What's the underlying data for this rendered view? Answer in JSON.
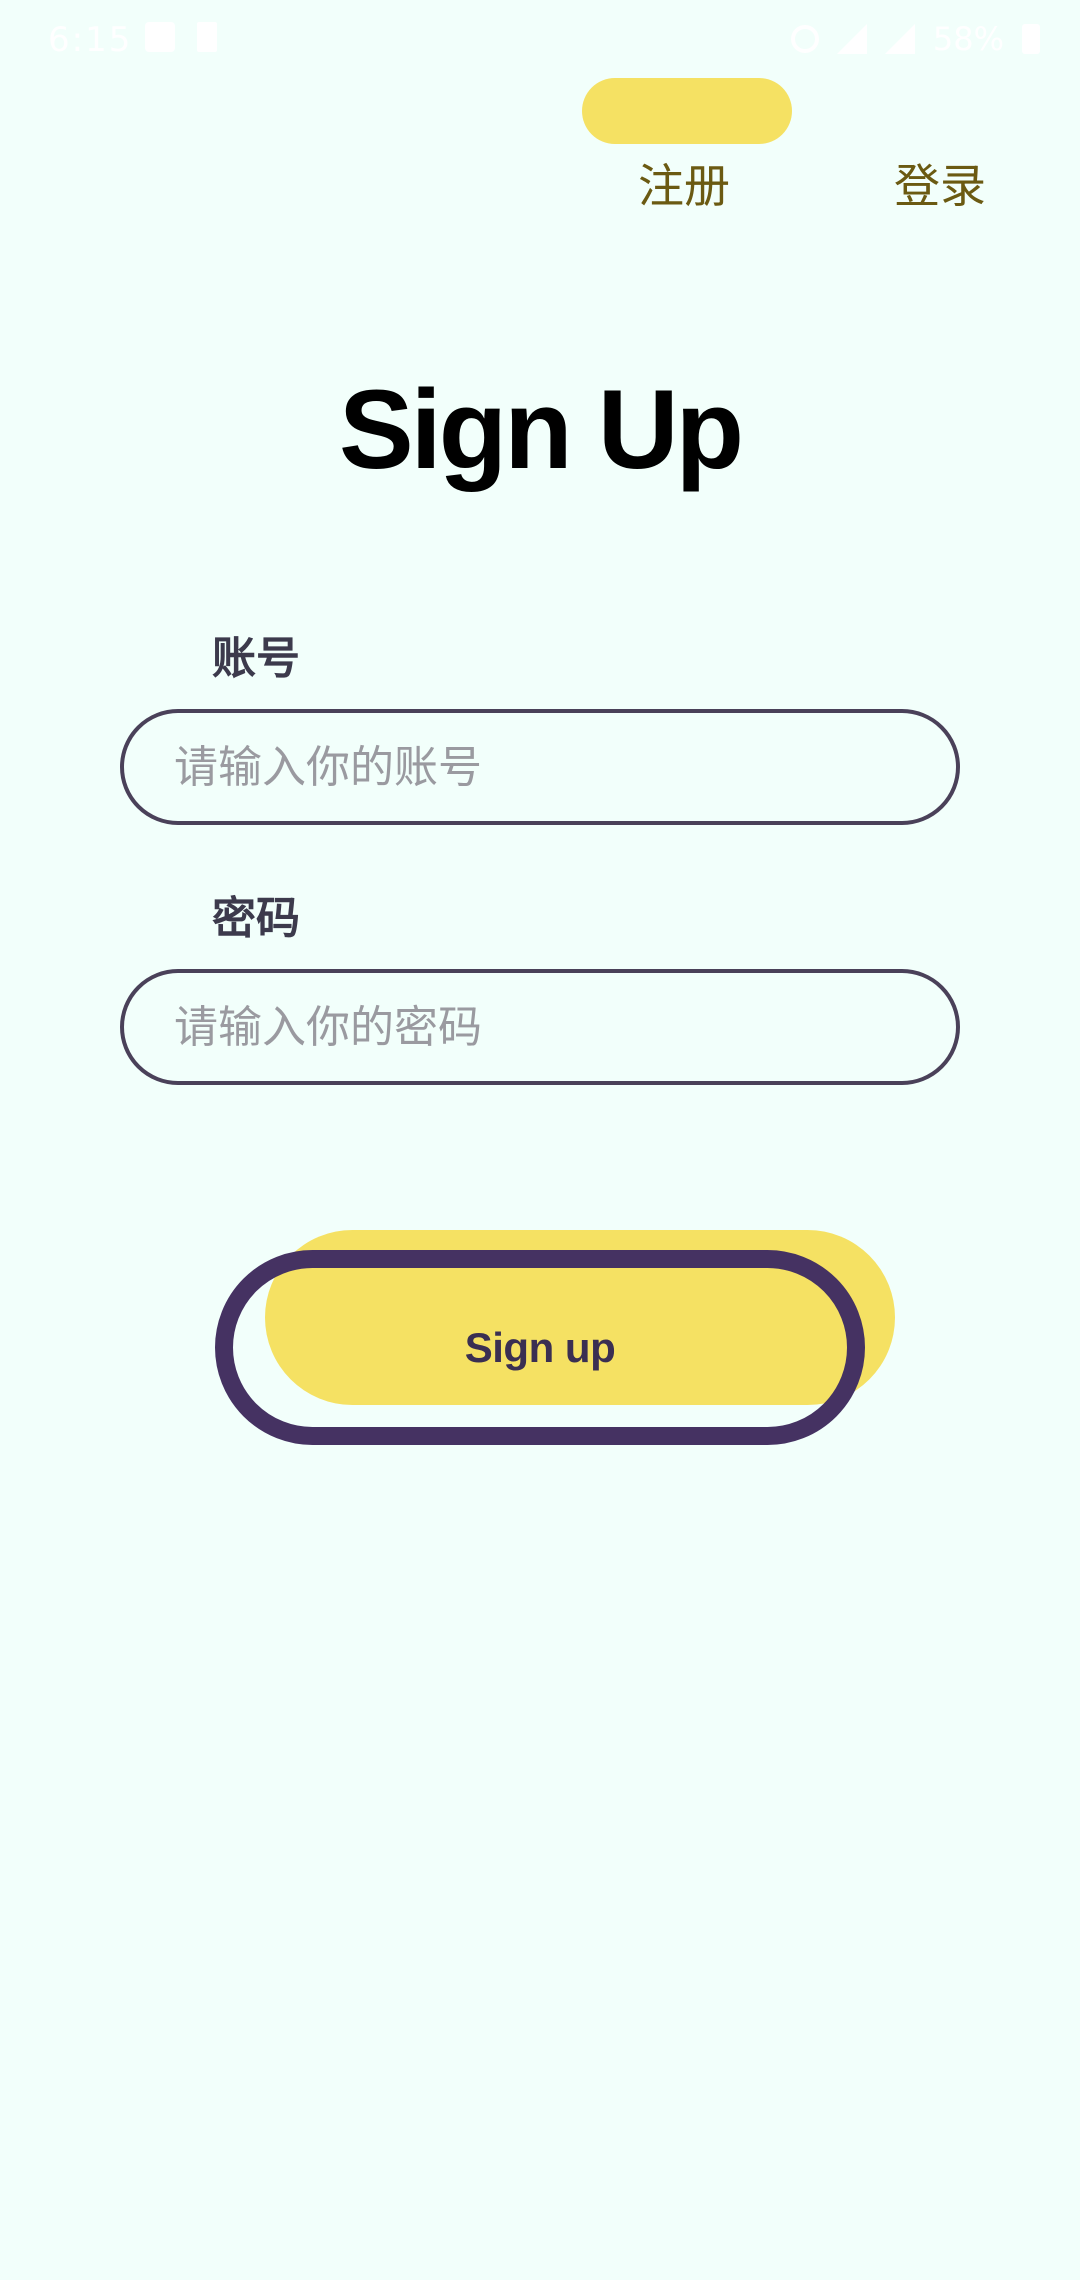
{
  "status_bar": {
    "time": "6:15",
    "battery_percent": "58%",
    "icons": [
      "image-icon",
      "bolt-icon",
      "circle-icon",
      "signal-icon",
      "wifi-icon",
      "battery-icon"
    ]
  },
  "tabs": {
    "signup_label": "注册",
    "login_label": "登录",
    "active": "signup"
  },
  "page": {
    "title": "Sign Up"
  },
  "form": {
    "account_label": "账号",
    "account_placeholder": "请输入你的账号",
    "account_value": "",
    "password_label": "密码",
    "password_placeholder": "请输入你的密码",
    "password_value": ""
  },
  "actions": {
    "signup_button_label": "Sign up"
  },
  "colors": {
    "background": "#f2fffb",
    "accent_yellow": "#f5e163",
    "outline_purple": "#453262",
    "tab_text": "#6b5a12"
  }
}
